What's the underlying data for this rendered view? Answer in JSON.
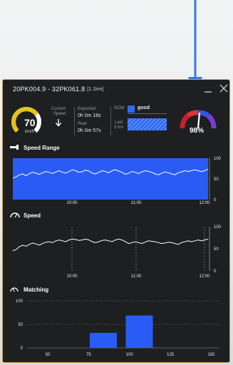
{
  "window": {
    "title": "20PK004.9 - 32PK061.8",
    "title_extra": "[1.1km]"
  },
  "speed_gauge": {
    "value": "70",
    "unit": "km/h",
    "fill": 0.7
  },
  "current_speed": {
    "label_line1": "Current",
    "label_line2": "Speed",
    "icon": "arrow-down-icon"
  },
  "times": {
    "expected_label": "Expected:",
    "expected_value": "0h 0m 18s",
    "real_label": "Real:",
    "real_value": "0h 0m 57s"
  },
  "traffic": {
    "now_label": "NOW",
    "now_status": "good",
    "last_label_line1": "Last",
    "last_label_line2": "3 hrs",
    "good_color": "#2f6cf2"
  },
  "confidence": {
    "value": "98%",
    "fraction": 0.98
  },
  "sections": {
    "speed_range": "Speed Range",
    "speed": "Speed",
    "matching": "Matching"
  },
  "colors": {
    "accent_blue": "#2a5cf5",
    "window_border": "#c99a4a",
    "background": "#1d1f21",
    "gauge_yellow": "#e6c21c"
  },
  "chart_data": [
    {
      "type": "area",
      "title": "Speed Range",
      "x_ticks": [
        "10:00",
        "11:00",
        "12:00"
      ],
      "y_ticks": [
        "100",
        "50",
        "0"
      ],
      "ylim": [
        0,
        100
      ],
      "band_low": [
        0,
        0,
        0,
        0,
        0,
        0,
        0,
        0,
        0,
        0,
        0,
        0,
        0,
        0,
        0,
        0,
        0,
        0,
        0,
        0,
        0,
        0,
        0,
        0,
        0,
        0,
        0,
        0,
        0,
        0,
        0,
        0,
        0,
        0,
        0,
        0,
        0,
        0,
        0,
        0,
        0,
        0,
        0,
        0,
        0,
        0,
        0,
        0,
        0,
        0,
        0,
        0,
        0,
        0,
        0,
        0,
        0,
        0,
        0,
        0
      ],
      "band_high": [
        100,
        100,
        100,
        100,
        100,
        100,
        100,
        100,
        100,
        100,
        100,
        100,
        100,
        100,
        100,
        100,
        100,
        100,
        100,
        100,
        100,
        100,
        100,
        100,
        100,
        100,
        100,
        100,
        100,
        100,
        100,
        100,
        100,
        100,
        100,
        100,
        100,
        100,
        100,
        100,
        100,
        100,
        100,
        100,
        100,
        100,
        100,
        100,
        100,
        100,
        100,
        100,
        100,
        100,
        100,
        100,
        100,
        100,
        100,
        100
      ],
      "line": [
        52,
        55,
        60,
        62,
        58,
        63,
        66,
        64,
        61,
        65,
        68,
        66,
        63,
        67,
        70,
        66,
        64,
        68,
        72,
        70,
        66,
        68,
        71,
        69,
        64,
        62,
        66,
        70,
        68,
        65,
        70,
        72,
        69,
        66,
        61,
        64,
        68,
        66,
        63,
        67,
        70,
        68,
        66,
        62,
        60,
        64,
        67,
        65,
        62,
        60,
        65,
        67,
        70,
        68,
        70,
        72,
        70,
        68,
        70,
        74
      ]
    },
    {
      "type": "line",
      "title": "Speed",
      "x_ticks": [
        "10:00",
        "11:00",
        "12:00"
      ],
      "y_ticks": [
        "100",
        "50",
        "0"
      ],
      "ylim": [
        0,
        100
      ],
      "values": [
        46,
        48,
        55,
        58,
        56,
        60,
        63,
        61,
        58,
        62,
        65,
        66,
        64,
        68,
        70,
        68,
        66,
        70,
        72,
        71,
        69,
        70,
        72,
        70,
        66,
        64,
        66,
        69,
        70,
        68,
        66,
        70,
        72,
        70,
        66,
        62,
        64,
        66,
        64,
        62,
        65,
        68,
        67,
        66,
        64,
        62,
        63,
        65,
        64,
        62,
        60,
        64,
        66,
        68,
        66,
        68,
        70,
        68,
        70,
        72
      ]
    },
    {
      "type": "bar",
      "title": "Matching",
      "x_ticks": [
        "50",
        "75",
        "100",
        "125",
        "150"
      ],
      "y_ticks": [
        "100",
        "50",
        "0"
      ],
      "xlim": [
        40,
        155
      ],
      "ylim": [
        0,
        100
      ],
      "bars": [
        {
          "x": 84,
          "value": 32
        },
        {
          "x": 106,
          "value": 69
        }
      ]
    }
  ]
}
